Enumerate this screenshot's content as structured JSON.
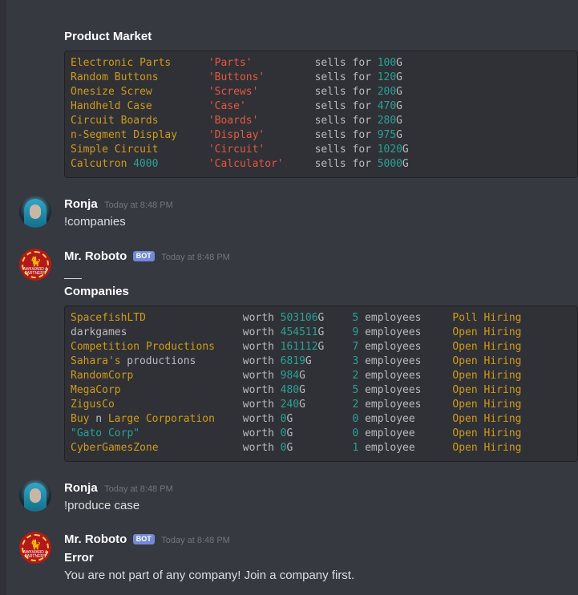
{
  "product_market": {
    "title": "Product Market",
    "rows": [
      {
        "name": "Electronic Parts",
        "name_num": "",
        "key": "'Parts'",
        "sells": "sells for",
        "price": "100",
        "unit": "G"
      },
      {
        "name": "Random Buttons",
        "name_num": "",
        "key": "'Buttons'",
        "sells": "sells for",
        "price": "120",
        "unit": "G"
      },
      {
        "name": "Onesize Screw",
        "name_num": "",
        "key": "'Screws'",
        "sells": "sells for",
        "price": "200",
        "unit": "G"
      },
      {
        "name": "Handheld Case",
        "name_num": "",
        "key": "'Case'",
        "sells": "sells for",
        "price": "470",
        "unit": "G"
      },
      {
        "name": "Circuit Boards",
        "name_num": "",
        "key": "'Boards'",
        "sells": "sells for",
        "price": "280",
        "unit": "G"
      },
      {
        "name": "n-Segment Display",
        "name_num": "",
        "key": "'Display'",
        "sells": "sells for",
        "price": "975",
        "unit": "G"
      },
      {
        "name": "Simple Circuit",
        "name_num": "",
        "key": "'Circuit'",
        "sells": "sells for",
        "price": "1020",
        "unit": "G"
      },
      {
        "name": "Calcutron",
        "name_num": "4000",
        "key": "'Calculator'",
        "sells": "sells for",
        "price": "5000",
        "unit": "G"
      }
    ]
  },
  "messages": {
    "ronja1": {
      "author": "Ronja",
      "time": "Today at 8:48 PM",
      "text": "!companies"
    },
    "roboto1": {
      "author": "Mr. Roboto",
      "badge": "BOT",
      "time": "Today at 8:48 PM"
    },
    "ronja2": {
      "author": "Ronja",
      "time": "Today at 8:48 PM",
      "text": "!produce case"
    },
    "roboto2": {
      "author": "Mr. Roboto",
      "badge": "BOT",
      "time": "Today at 8:48 PM",
      "title": "Error",
      "text": "You are not part of any company! Join a company first."
    }
  },
  "avatar_text": "AWKWARD A PARTNERS",
  "companies": {
    "title": "Companies",
    "rows": [
      {
        "name_parts": [
          [
            "SpacefishLTD",
            "y"
          ]
        ],
        "worth": "worth",
        "value": "503106",
        "unit": "G",
        "count": "5",
        "emp": "employees",
        "status": "Poll Hiring"
      },
      {
        "name_parts": [
          [
            "darkgames",
            "w"
          ]
        ],
        "worth": "worth",
        "value": "454511",
        "unit": "G",
        "count": "9",
        "emp": "employees",
        "status": "Open Hiring"
      },
      {
        "name_parts": [
          [
            "Competition Productions",
            "y"
          ]
        ],
        "worth": "worth",
        "value": "161112",
        "unit": "G",
        "count": "7",
        "emp": "employees",
        "status": "Open Hiring"
      },
      {
        "name_parts": [
          [
            "Sahara's",
            "y"
          ],
          [
            " productions",
            "w"
          ]
        ],
        "worth": "worth",
        "value": "6819",
        "unit": "G",
        "count": "3",
        "emp": "employees",
        "status": "Open Hiring"
      },
      {
        "name_parts": [
          [
            "RandomCorp",
            "y"
          ]
        ],
        "worth": "worth",
        "value": "984",
        "unit": "G",
        "count": "2",
        "emp": "employees",
        "status": "Open Hiring"
      },
      {
        "name_parts": [
          [
            "MegaCorp",
            "y"
          ]
        ],
        "worth": "worth",
        "value": "480",
        "unit": "G",
        "count": "5",
        "emp": "employees",
        "status": "Open Hiring"
      },
      {
        "name_parts": [
          [
            "ZigusCo",
            "y"
          ]
        ],
        "worth": "worth",
        "value": "240",
        "unit": "G",
        "count": "2",
        "emp": "employees",
        "status": "Open Hiring"
      },
      {
        "name_parts": [
          [
            "Buy",
            "y"
          ],
          [
            " n ",
            "w"
          ],
          [
            "Large Corporation",
            "y"
          ]
        ],
        "worth": "worth",
        "value": "0",
        "unit": "G",
        "count": "0",
        "emp": "employee",
        "status": "Open Hiring"
      },
      {
        "name_parts": [
          [
            "\"Gato Corp\"",
            "g"
          ]
        ],
        "worth": "worth",
        "value": "0",
        "unit": "G",
        "count": "0",
        "emp": "employee",
        "status": "Open Hiring"
      },
      {
        "name_parts": [
          [
            "CyberGamesZone",
            "y"
          ]
        ],
        "worth": "worth",
        "value": "0",
        "unit": "G",
        "count": "1",
        "emp": "employee",
        "status": "Open Hiring"
      }
    ]
  },
  "colors": {
    "background": "#36393f",
    "code_bg": "#2f3136",
    "yellow": "#d19a18",
    "red": "#e8573f",
    "cyan": "#2aa198",
    "bot_badge": "#7289da"
  }
}
